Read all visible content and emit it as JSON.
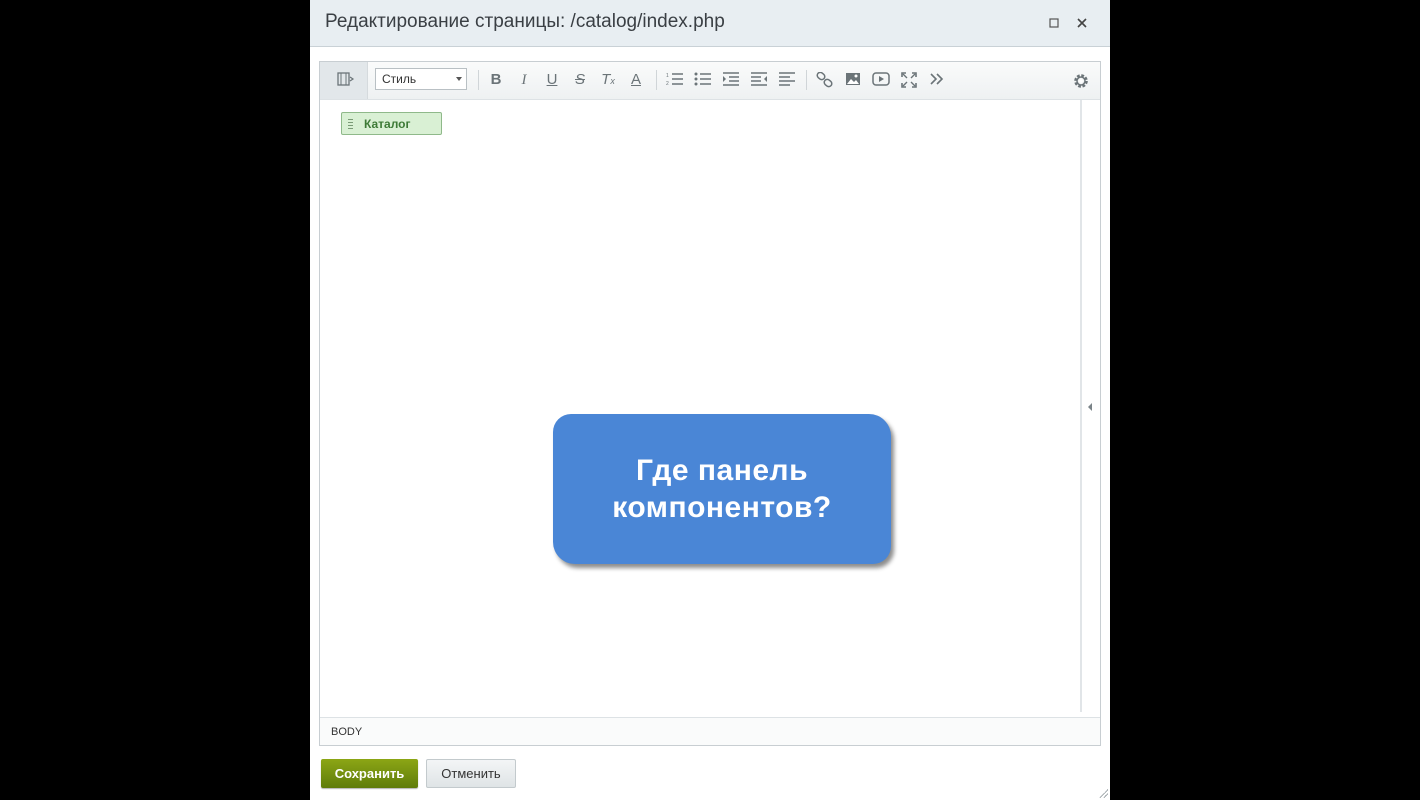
{
  "dialog": {
    "title": "Редактирование страницы: /catalog/index.php",
    "maximize_icon": "maximize-icon",
    "close_icon": "close-icon"
  },
  "toolbar": {
    "style_select_value": "Стиль",
    "icons": [
      "view-mode-icon",
      "bold-icon",
      "italic-icon",
      "underline-icon",
      "strikethrough-icon",
      "remove-format-icon",
      "font-color-icon",
      "ordered-list-icon",
      "unordered-list-icon",
      "indent-icon",
      "outdent-icon",
      "align-left-icon",
      "link-icon",
      "image-icon",
      "video-icon",
      "fullscreen-icon",
      "more-icon",
      "settings-icon"
    ]
  },
  "content": {
    "component_label": "Каталог",
    "callout_line1": "Где панель",
    "callout_line2": "компонентов?"
  },
  "statusbar": {
    "path": "BODY"
  },
  "buttons": {
    "save": "Сохранить",
    "cancel": "Отменить"
  },
  "colors": {
    "save_button": "#7a9512",
    "callout": "#4a86d6",
    "chip_bg": "#d9f0d4"
  }
}
